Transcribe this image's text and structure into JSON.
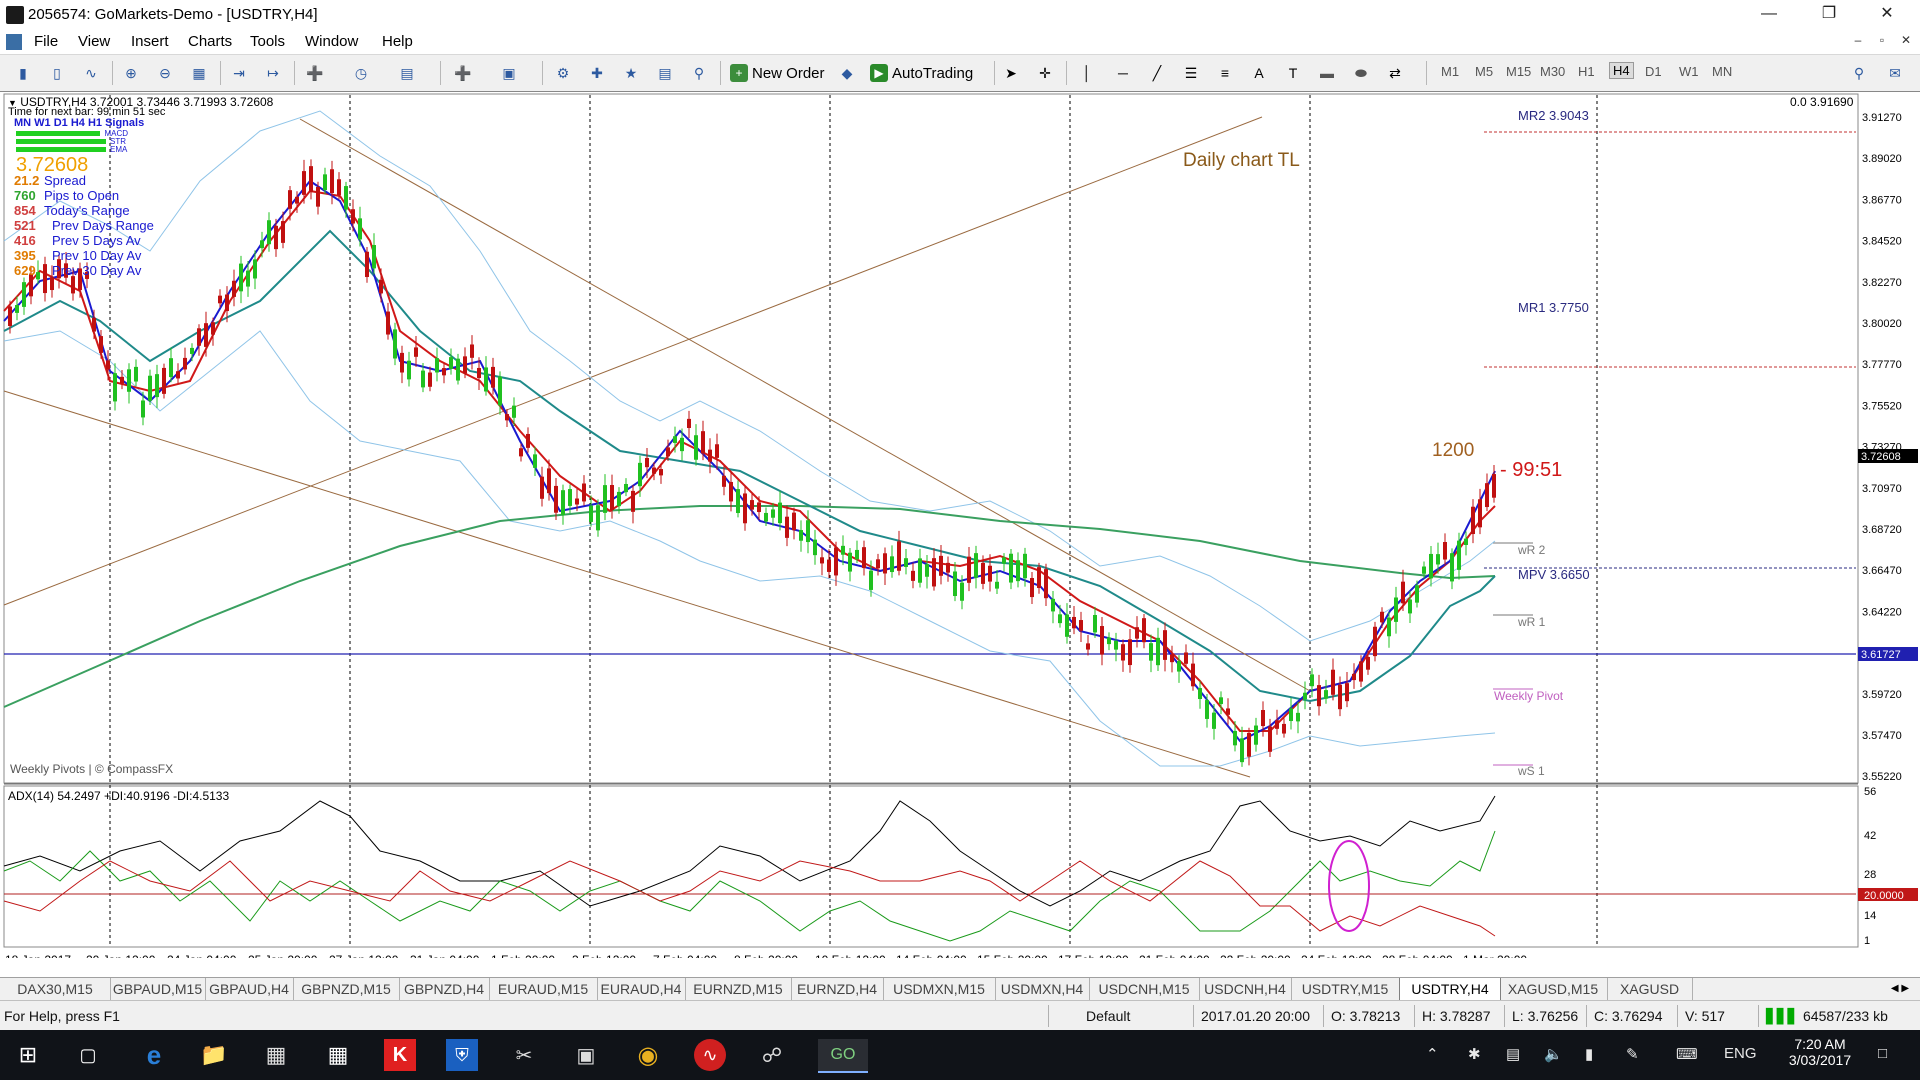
{
  "window": {
    "title": "2056574: GoMarkets-Demo - [USDTRY,H4]",
    "minimize_icon": "minimize-icon",
    "maximize_icon": "restore-icon",
    "close_icon": "close-icon"
  },
  "menu": {
    "items": [
      "File",
      "View",
      "Insert",
      "Charts",
      "Tools",
      "Window",
      "Help"
    ]
  },
  "toolbar": {
    "new_order_label": "New Order",
    "autotrading_label": "AutoTrading",
    "timeframes": [
      "M1",
      "M5",
      "M15",
      "M30",
      "H1",
      "H4",
      "D1",
      "W1",
      "MN"
    ],
    "active_timeframe": "H4"
  },
  "chart": {
    "symbol_header": "USDTRY,H4  3.72001 3.73446 3.71993 3.72608",
    "right_top_value": "0.0 3.91690",
    "time_next_bar": "Time for next bar: 99 min 51 sec",
    "indicator_strip": "MN W1 D1 H4 H1  Signals",
    "indicator_rows": [
      "MACD",
      "STR",
      "EMA"
    ],
    "current_price_large": "3.72608",
    "stats": [
      {
        "value": "21.2",
        "label": "Spread",
        "color": "#e07b00"
      },
      {
        "value": "760",
        "label": "Pips to Open",
        "color": "#2fa52f"
      },
      {
        "value": "854",
        "label": "Today's Range",
        "color": "#d04040"
      },
      {
        "value": "521",
        "label": "Prev Days Range",
        "color": "#d04040"
      },
      {
        "value": "416",
        "label": "Prev 5 Days Av",
        "color": "#d04040"
      },
      {
        "value": "395",
        "label": "Prev 10 Day Av",
        "color": "#e07b00"
      },
      {
        "value": "629",
        "label": "Prev 30 Day Av",
        "color": "#e07b00"
      }
    ],
    "annotation_daily_tl": "Daily chart TL",
    "annotation_1200": "1200",
    "countdown": "- 99:51",
    "watermark": "Weekly Pivots | © CompassFX",
    "pivots": [
      {
        "label": "MR2 3.9043"
      },
      {
        "label": "MR1 3.7750"
      },
      {
        "label": "wR 2"
      },
      {
        "label": "MPV 3.6650"
      },
      {
        "label": "wR 1"
      },
      {
        "label": "Weekly Pivot"
      },
      {
        "label": "wS 1"
      }
    ],
    "price_axis": [
      "3.91270",
      "3.89020",
      "3.86770",
      "3.84520",
      "3.82270",
      "3.80020",
      "3.77770",
      "3.75520",
      "3.73270",
      "3.70970",
      "3.68720",
      "3.66470",
      "3.64220",
      "3.61727",
      "3.59720",
      "3.57470",
      "3.55220"
    ],
    "current_price_tag": "3.72608",
    "hline_price_tag": "3.61727",
    "time_axis": [
      "18 Jan 2017",
      "20 Jan 12:00",
      "24 Jan 04:00",
      "25 Jan 20:00",
      "27 Jan 12:00",
      "31 Jan 04:00",
      "1 Feb 20:00",
      "3 Feb 12:00",
      "7 Feb 04:00",
      "8 Feb 20:00",
      "10 Feb 12:00",
      "14 Feb 04:00",
      "15 Feb 20:00",
      "17 Feb 12:00",
      "21 Feb 04:00",
      "22 Feb 20:00",
      "24 Feb 12:00",
      "28 Feb 04:00",
      "1 Mar 20:00"
    ]
  },
  "adx": {
    "header": "ADX(14) 54.2497 +DI:40.9196 -DI:4.5133",
    "axis": [
      "56",
      "42",
      "28",
      "14",
      "1"
    ],
    "level_tag": "20.0000"
  },
  "tabs": [
    "DAX30,M15",
    "GBPAUD,M15",
    "GBPAUD,H4",
    "GBPNZD,M15",
    "GBPNZD,H4",
    "EURAUD,M15",
    "EURAUD,H4",
    "EURNZD,M15",
    "EURNZD,H4",
    "USDMXN,M15",
    "USDMXN,H4",
    "USDCNH,M15",
    "USDCNH,H4",
    "USDTRY,M15",
    "USDTRY,H4",
    "XAGUSD,M15",
    "XAGUSD"
  ],
  "active_tab": "USDTRY,H4",
  "status": {
    "help": "For Help, press F1",
    "profile": "Default",
    "datetime": "2017.01.20 20:00",
    "open": "O: 3.78213",
    "high": "H: 3.78287",
    "low": "L: 3.76256",
    "close": "C: 3.76294",
    "volume": "V: 517",
    "traffic": "64587/233 kb"
  },
  "taskbar": {
    "lang": "ENG",
    "time": "7:20 AM",
    "date": "3/03/2017"
  }
}
